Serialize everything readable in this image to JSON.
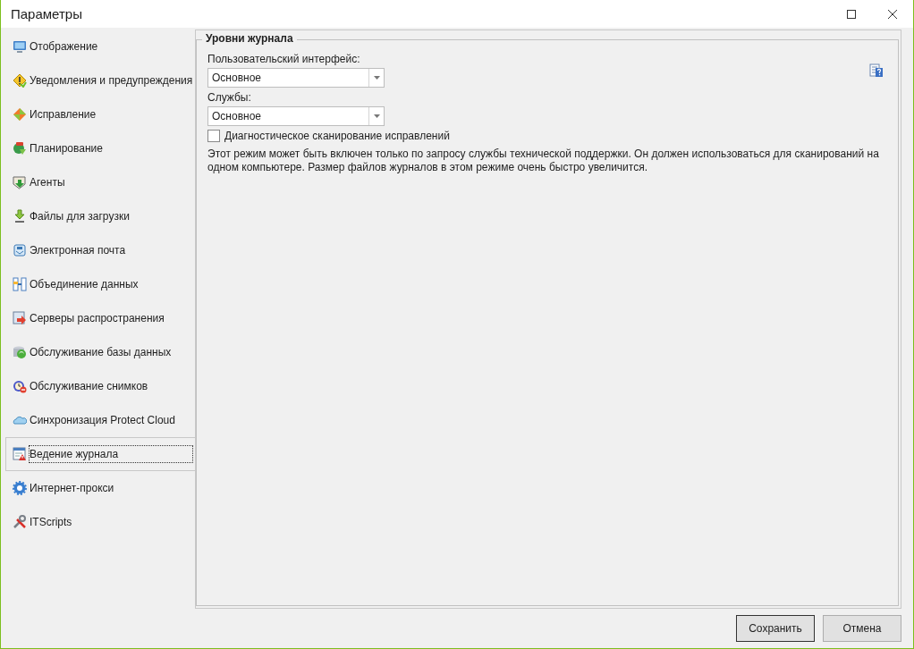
{
  "window": {
    "title": "Параметры"
  },
  "sidebar": {
    "items": [
      {
        "label": "Отображение",
        "selected": false
      },
      {
        "label": "Уведомления и предупреждения",
        "selected": false
      },
      {
        "label": "Исправление",
        "selected": false
      },
      {
        "label": "Планирование",
        "selected": false
      },
      {
        "label": "Агенты",
        "selected": false
      },
      {
        "label": "Файлы для загрузки",
        "selected": false
      },
      {
        "label": "Электронная почта",
        "selected": false
      },
      {
        "label": "Объединение данных",
        "selected": false
      },
      {
        "label": "Серверы распространения",
        "selected": false
      },
      {
        "label": "Обслуживание базы данных",
        "selected": false
      },
      {
        "label": "Обслуживание снимков",
        "selected": false
      },
      {
        "label": "Синхронизация Protect Cloud",
        "selected": false
      },
      {
        "label": "Ведение журнала",
        "selected": true
      },
      {
        "label": "Интернет-прокси",
        "selected": false
      },
      {
        "label": "ITScripts",
        "selected": false
      }
    ]
  },
  "group": {
    "title": "Уровни журнала",
    "fields": [
      {
        "label": "Пользовательский интерфейс:",
        "value": "Основное"
      },
      {
        "label": "Службы:",
        "value": "Основное"
      }
    ],
    "checkbox": {
      "label": "Диагностическое сканирование исправлений",
      "checked": false
    },
    "description": "Этот режим может быть включен только по запросу службы технической поддержки. Он должен использоваться для сканирований на одном компьютере. Размер файлов журналов в этом режиме очень быстро увеличится."
  },
  "buttons": [
    {
      "label": "Сохранить",
      "default": true
    },
    {
      "label": "Отмена",
      "default": false
    }
  ]
}
